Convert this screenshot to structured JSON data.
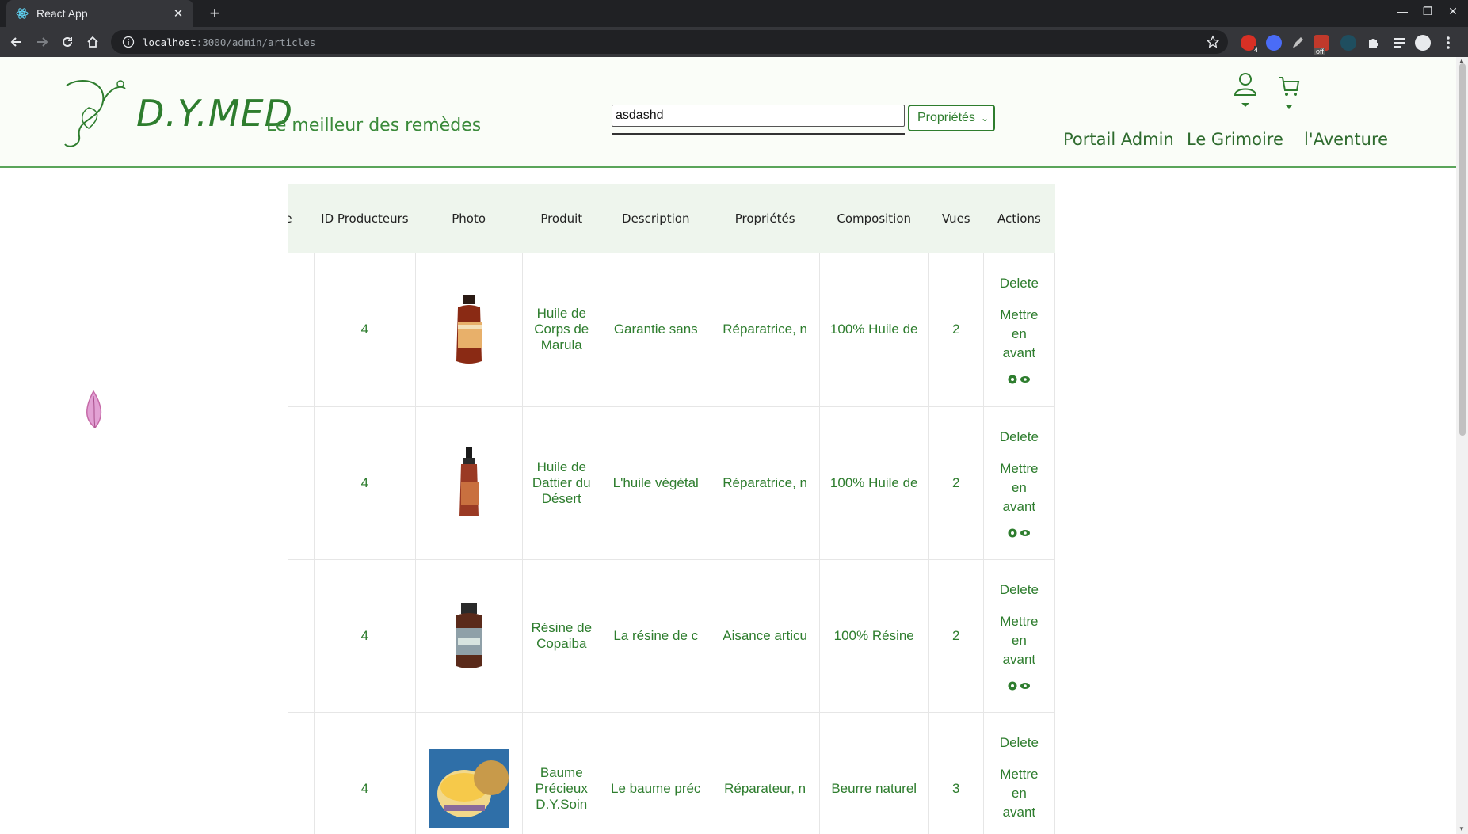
{
  "browser": {
    "tab_title": "React App",
    "url_host": "localhost",
    "url_path": ":3000/admin/articles",
    "ext_badge_count": "4",
    "ext_off_label": "off"
  },
  "header": {
    "brand": "D.Y.MED",
    "tagline": "Le meilleur des remèdes",
    "search_value": "asdashd",
    "filter_selected": "Propriétés",
    "nav": [
      "Portail Admin",
      "Le Grimoire",
      "l'Aventure"
    ]
  },
  "table": {
    "columns": [
      "orie",
      "ID Producteurs",
      "Photo",
      "Produit",
      "Description",
      "Propriétés",
      "Composition",
      "Vues",
      "Actions"
    ],
    "rows": [
      {
        "producer_id": "4",
        "product": "Huile de Corps de Marula",
        "description": "Garantie sans",
        "properties": "Réparatrice, n",
        "composition": "100% Huile de",
        "views": "2"
      },
      {
        "producer_id": "4",
        "product": "Huile de Dattier du Désert",
        "description": "L'huile végétal",
        "properties": "Réparatrice, n",
        "composition": "100% Huile de",
        "views": "2"
      },
      {
        "producer_id": "4",
        "product": "Résine de Copaiba",
        "description": "La résine de c",
        "properties": "Aisance articu",
        "composition": "100% Résine",
        "views": "2"
      },
      {
        "producer_id": "4",
        "product": "Baume Précieux D.Y.Soin",
        "description": "Le baume préc",
        "properties": "Réparateur, n",
        "composition": "Beurre naturel",
        "views": "3"
      }
    ],
    "actions": {
      "delete": "Delete",
      "feature": "Mettre en avant"
    }
  },
  "colors": {
    "brand_green": "#2e7d2e",
    "header_bg": "#fafdf8",
    "table_header_bg": "#eef5ed"
  },
  "icons": [
    "react-favicon",
    "info-icon",
    "star-icon",
    "user-icon",
    "cart-icon",
    "gear-icon",
    "eye-icon",
    "petal-icon"
  ]
}
